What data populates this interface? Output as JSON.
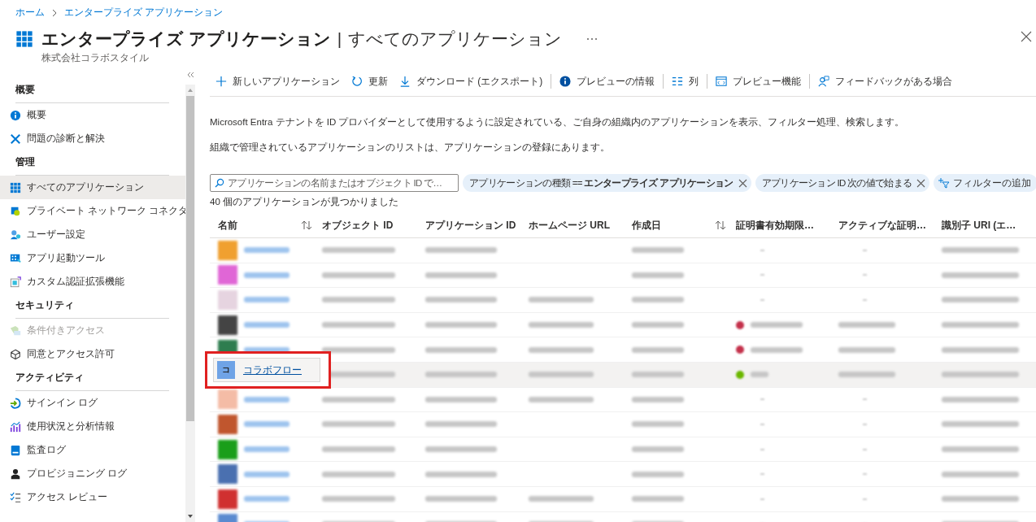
{
  "breadcrumb": [
    "ホーム",
    "エンタープライズ アプリケーション"
  ],
  "header": {
    "title": "エンタープライズ アプリケーション",
    "separator": "|",
    "section": "すべてのアプリケーション",
    "subtitle": "株式会社コラボスタイル"
  },
  "sidebar": {
    "sections": [
      {
        "title": "概要",
        "items": [
          {
            "label": "概要",
            "selected": false,
            "disabled": false
          },
          {
            "label": "問題の診断と解決",
            "selected": false,
            "disabled": false
          }
        ]
      },
      {
        "title": "管理",
        "items": [
          {
            "label": "すべてのアプリケーション",
            "selected": true,
            "disabled": false
          },
          {
            "label": "プライベート ネットワーク コネクタ",
            "selected": false,
            "disabled": false
          },
          {
            "label": "ユーザー設定",
            "selected": false,
            "disabled": false
          },
          {
            "label": "アプリ起動ツール",
            "selected": false,
            "disabled": false
          },
          {
            "label": "カスタム認証拡張機能",
            "selected": false,
            "disabled": false
          }
        ]
      },
      {
        "title": "セキュリティ",
        "items": [
          {
            "label": "条件付きアクセス",
            "selected": false,
            "disabled": true
          },
          {
            "label": "同意とアクセス許可",
            "selected": false,
            "disabled": false
          }
        ]
      },
      {
        "title": "アクティビティ",
        "items": [
          {
            "label": "サインイン ログ",
            "selected": false,
            "disabled": false
          },
          {
            "label": "使用状況と分析情報",
            "selected": false,
            "disabled": false
          },
          {
            "label": "監査ログ",
            "selected": false,
            "disabled": false
          },
          {
            "label": "プロビジョニング ログ",
            "selected": false,
            "disabled": false
          },
          {
            "label": "アクセス レビュー",
            "selected": false,
            "disabled": false
          }
        ]
      }
    ]
  },
  "toolbar": [
    {
      "label": "新しいアプリケーション"
    },
    {
      "label": "更新"
    },
    {
      "label": "ダウンロード (エクスポート)"
    },
    {
      "label": "プレビューの情報"
    },
    {
      "label": "列"
    },
    {
      "label": "プレビュー機能"
    },
    {
      "label": "フィードバックがある場合"
    }
  ],
  "description": [
    "Microsoft Entra テナントを ID プロバイダーとして使用するように設定されている、ご自身の組織内のアプリケーションを表示、フィルター処理、検索します。",
    "組織で管理されているアプリケーションのリストは、アプリケーションの登録にあります。"
  ],
  "search": {
    "placeholder": "アプリケーションの名前またはオブジェクト ID で…"
  },
  "filters": [
    {
      "label": "アプリケーションの種類 == **エンタープライズ アプリケーション**"
    },
    {
      "label": "アプリケーション ID 次の値で始まる"
    }
  ],
  "add_filter": "フィルターの追加",
  "result_count": "40 個のアプリケーションが見つかりました",
  "table": {
    "columns": [
      {
        "label": "名前",
        "sortable": true
      },
      {
        "label": "オブジェクト ID",
        "sortable": false
      },
      {
        "label": "アプリケーション ID",
        "sortable": false
      },
      {
        "label": "ホームページ URL",
        "sortable": false
      },
      {
        "label": "作成日",
        "sortable": true
      },
      {
        "label": "証明書有効期限…",
        "sortable": false
      },
      {
        "label": "アクティブな証明…",
        "sortable": false
      },
      {
        "label": "識別子 URI (エ…",
        "sortable": false
      }
    ],
    "rows": [
      {
        "color": "#f0a030",
        "url": false,
        "selected": false
      },
      {
        "color": "#e066d6",
        "url": false,
        "selected": false
      },
      {
        "color": "#e6d4e0",
        "url": true,
        "selected": false
      },
      {
        "color": "#444444",
        "cert": {
          "color": "#c4314b"
        },
        "url": true,
        "selected": false
      },
      {
        "color": "#2e7d4f",
        "cert": {
          "color": "#c4314b"
        },
        "url": true,
        "selected": false
      },
      {
        "color": "#6fa3e6",
        "cert": {
          "color": "#6bb700"
        },
        "url": true,
        "selected": true,
        "name": "コラボフロー",
        "initial": "コ",
        "highlighted": true
      },
      {
        "color": "#f4bca6",
        "url": true,
        "selected": false
      },
      {
        "color": "#c0562e",
        "url": false,
        "selected": false
      },
      {
        "color": "#1a9e1a",
        "url": false,
        "selected": false
      },
      {
        "color": "#4a70b0",
        "url": false,
        "selected": false
      },
      {
        "color": "#d03030",
        "url": true,
        "selected": false
      },
      {
        "color": "#5a8ad0",
        "url": true,
        "selected": false
      }
    ]
  }
}
